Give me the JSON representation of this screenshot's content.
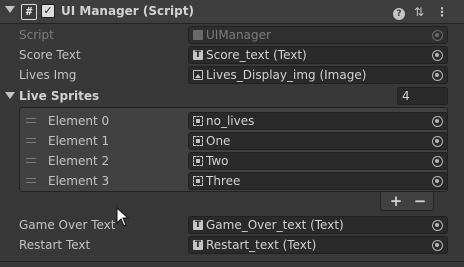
{
  "component": {
    "title": "UI Manager (Script)",
    "script_glyph": "#",
    "enabled_glyph": "✓",
    "help_glyph": "?",
    "presets_glyph": "⇅",
    "more_glyph": "⋮"
  },
  "fields": {
    "script": {
      "label": "Script",
      "value": "UIManager",
      "icon": "script-asset-icon"
    },
    "score_text": {
      "label": "Score Text",
      "value": "Score_text (Text)",
      "icon": "text-component-icon"
    },
    "lives_img": {
      "label": "Lives Img",
      "value": "Lives_Display_img (Image)",
      "icon": "image-component-icon"
    },
    "game_over_text": {
      "label": "Game Over Text",
      "value": "Game_Over_text (Text)",
      "icon": "text-component-icon"
    },
    "restart_text": {
      "label": "Restart Text",
      "value": "Restart_text (Text)",
      "icon": "text-component-icon"
    }
  },
  "live_sprites": {
    "label": "Live Sprites",
    "size": "4",
    "elements": [
      {
        "label": "Element 0",
        "value": "no_lives"
      },
      {
        "label": "Element 1",
        "value": "One"
      },
      {
        "label": "Element 2",
        "value": "Two"
      },
      {
        "label": "Element 3",
        "value": "Three"
      }
    ],
    "add_label": "+",
    "remove_label": "−"
  },
  "colors": {
    "background": "#383838",
    "field_background": "#2a2a2a",
    "text": "#c4c4c4",
    "disabled_text": "#7c7c7c"
  }
}
